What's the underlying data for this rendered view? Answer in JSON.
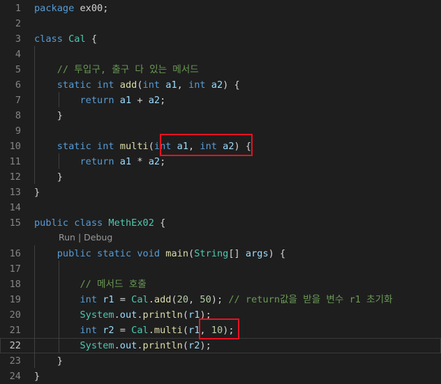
{
  "lines": [
    {
      "num": "1",
      "tokens": [
        [
          "k",
          "package"
        ],
        [
          "p",
          " ex00;"
        ]
      ]
    },
    {
      "num": "2",
      "tokens": []
    },
    {
      "num": "3",
      "tokens": [
        [
          "k",
          "class"
        ],
        [
          "p",
          " "
        ],
        [
          "t",
          "Cal"
        ],
        [
          "p",
          " {"
        ]
      ]
    },
    {
      "num": "4",
      "tokens": []
    },
    {
      "num": "5",
      "tokens": [
        [
          "p",
          "    "
        ],
        [
          "c",
          "// 투입구, 출구 다 있는 메서드"
        ]
      ]
    },
    {
      "num": "6",
      "tokens": [
        [
          "p",
          "    "
        ],
        [
          "k",
          "static"
        ],
        [
          "p",
          " "
        ],
        [
          "k",
          "int"
        ],
        [
          "p",
          " "
        ],
        [
          "f",
          "add"
        ],
        [
          "p",
          "("
        ],
        [
          "k",
          "int"
        ],
        [
          "p",
          " "
        ],
        [
          "v",
          "a1"
        ],
        [
          "p",
          ", "
        ],
        [
          "k",
          "int"
        ],
        [
          "p",
          " "
        ],
        [
          "v",
          "a2"
        ],
        [
          "p",
          ") {"
        ]
      ]
    },
    {
      "num": "7",
      "tokens": [
        [
          "p",
          "        "
        ],
        [
          "k",
          "return"
        ],
        [
          "p",
          " "
        ],
        [
          "v",
          "a1"
        ],
        [
          "p",
          " + "
        ],
        [
          "v",
          "a2"
        ],
        [
          "p",
          ";"
        ]
      ]
    },
    {
      "num": "8",
      "tokens": [
        [
          "p",
          "    }"
        ]
      ]
    },
    {
      "num": "9",
      "tokens": []
    },
    {
      "num": "10",
      "tokens": [
        [
          "p",
          "    "
        ],
        [
          "k",
          "static"
        ],
        [
          "p",
          " "
        ],
        [
          "k",
          "int"
        ],
        [
          "p",
          " "
        ],
        [
          "f",
          "multi"
        ],
        [
          "p",
          "("
        ],
        [
          "k",
          "int"
        ],
        [
          "p",
          " "
        ],
        [
          "v",
          "a1"
        ],
        [
          "p",
          ", "
        ],
        [
          "k",
          "int"
        ],
        [
          "p",
          " "
        ],
        [
          "v",
          "a2"
        ],
        [
          "p",
          ") {"
        ]
      ]
    },
    {
      "num": "11",
      "tokens": [
        [
          "p",
          "        "
        ],
        [
          "k",
          "return"
        ],
        [
          "p",
          " "
        ],
        [
          "v",
          "a1"
        ],
        [
          "p",
          " * "
        ],
        [
          "v",
          "a2"
        ],
        [
          "p",
          ";"
        ]
      ]
    },
    {
      "num": "12",
      "tokens": [
        [
          "p",
          "    }"
        ]
      ]
    },
    {
      "num": "13",
      "tokens": [
        [
          "p",
          "}"
        ]
      ]
    },
    {
      "num": "14",
      "tokens": []
    },
    {
      "num": "15",
      "tokens": [
        [
          "k",
          "public"
        ],
        [
          "p",
          " "
        ],
        [
          "k",
          "class"
        ],
        [
          "p",
          " "
        ],
        [
          "t",
          "MethEx02"
        ],
        [
          "p",
          " {"
        ]
      ]
    },
    {
      "num": "16",
      "tokens": [
        [
          "p",
          "    "
        ],
        [
          "k",
          "public"
        ],
        [
          "p",
          " "
        ],
        [
          "k",
          "static"
        ],
        [
          "p",
          " "
        ],
        [
          "k",
          "void"
        ],
        [
          "p",
          " "
        ],
        [
          "f",
          "main"
        ],
        [
          "p",
          "("
        ],
        [
          "t",
          "String"
        ],
        [
          "p",
          "[] "
        ],
        [
          "v",
          "args"
        ],
        [
          "p",
          ") {"
        ]
      ]
    },
    {
      "num": "17",
      "tokens": []
    },
    {
      "num": "18",
      "tokens": [
        [
          "p",
          "        "
        ],
        [
          "c",
          "// 메서드 호출"
        ]
      ]
    },
    {
      "num": "19",
      "tokens": [
        [
          "p",
          "        "
        ],
        [
          "k",
          "int"
        ],
        [
          "p",
          " "
        ],
        [
          "v",
          "r1"
        ],
        [
          "p",
          " = "
        ],
        [
          "t",
          "Cal"
        ],
        [
          "p",
          "."
        ],
        [
          "f",
          "add"
        ],
        [
          "p",
          "("
        ],
        [
          "n",
          "20"
        ],
        [
          "p",
          ", "
        ],
        [
          "n",
          "50"
        ],
        [
          "p",
          "); "
        ],
        [
          "c",
          "// return값을 받을 변수 r1 초기화"
        ]
      ]
    },
    {
      "num": "20",
      "tokens": [
        [
          "p",
          "        "
        ],
        [
          "t",
          "System"
        ],
        [
          "p",
          "."
        ],
        [
          "v",
          "out"
        ],
        [
          "p",
          "."
        ],
        [
          "f",
          "println"
        ],
        [
          "p",
          "("
        ],
        [
          "v",
          "r1"
        ],
        [
          "p",
          ");"
        ]
      ]
    },
    {
      "num": "21",
      "tokens": [
        [
          "p",
          "        "
        ],
        [
          "k",
          "int"
        ],
        [
          "p",
          " "
        ],
        [
          "v",
          "r2"
        ],
        [
          "p",
          " = "
        ],
        [
          "t",
          "Cal"
        ],
        [
          "p",
          "."
        ],
        [
          "f",
          "multi"
        ],
        [
          "p",
          "("
        ],
        [
          "v",
          "r1"
        ],
        [
          "p",
          ", "
        ],
        [
          "n",
          "10"
        ],
        [
          "p",
          ");"
        ]
      ]
    },
    {
      "num": "22",
      "tokens": [
        [
          "p",
          "        "
        ],
        [
          "t",
          "System"
        ],
        [
          "p",
          "."
        ],
        [
          "v",
          "out"
        ],
        [
          "p",
          "."
        ],
        [
          "f",
          "println"
        ],
        [
          "p",
          "("
        ],
        [
          "v",
          "r2"
        ],
        [
          "p",
          ");"
        ]
      ]
    },
    {
      "num": "23",
      "tokens": [
        [
          "p",
          "    }"
        ]
      ]
    },
    {
      "num": "24",
      "tokens": [
        [
          "p",
          "}"
        ]
      ]
    }
  ],
  "codelens": {
    "run": "Run",
    "separator": " | ",
    "debug": "Debug"
  },
  "current_line": "22",
  "colors": {
    "background": "#1e1e1e",
    "keyword": "#569cd6",
    "type": "#4ec9b0",
    "function": "#dcdcaa",
    "variable": "#9cdcfe",
    "number": "#b5cea8",
    "comment": "#6a9955",
    "highlight_box": "#e81123"
  }
}
